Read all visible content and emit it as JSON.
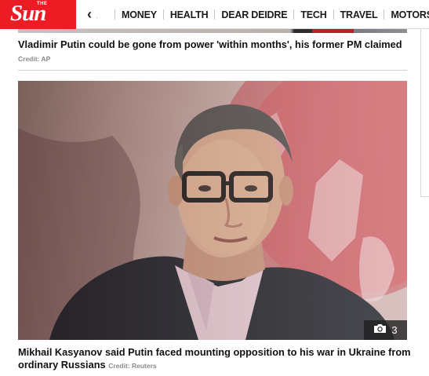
{
  "brand": {
    "logo_small": "THE",
    "logo_main": "Sun",
    "color": "#eb1c24"
  },
  "nav": {
    "back_icon": "chevron-left-icon",
    "items": [
      {
        "label": "MONEY"
      },
      {
        "label": "HEALTH"
      },
      {
        "label": "DEAR DEIDRE"
      },
      {
        "label": "TECH"
      },
      {
        "label": "TRAVEL"
      },
      {
        "label": "MOTORS"
      }
    ]
  },
  "articles": [
    {
      "caption": "Vladimir Putin could be gone from power 'within months', his former PM claimed",
      "credit": "Credit: AP"
    },
    {
      "caption": "Mikhail Kasyanov said Putin faced mounting opposition to his war in Ukraine from ordinary Russians",
      "credit": "Credit: Reuters",
      "gallery": {
        "icon": "camera-icon",
        "count": "3"
      }
    }
  ]
}
